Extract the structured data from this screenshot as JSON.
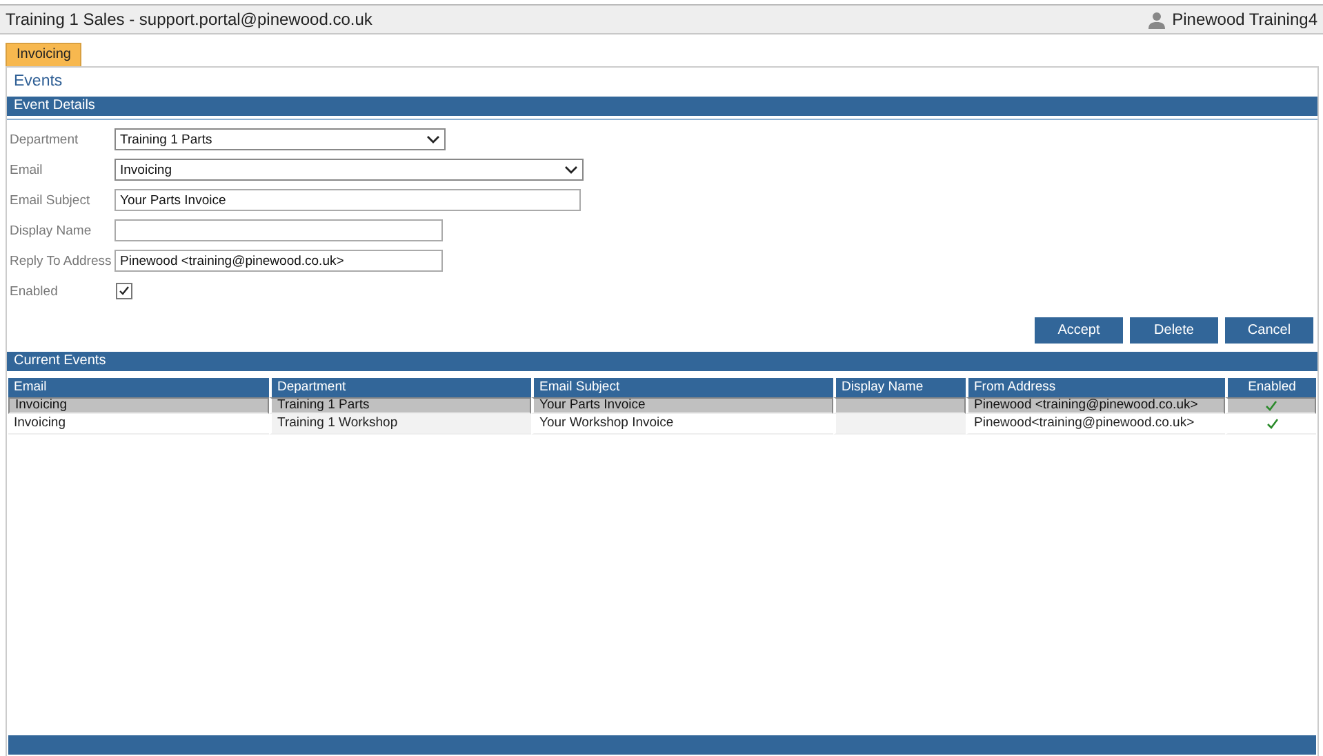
{
  "window": {
    "title": "Training 1 Sales - support.portal@pinewood.co.uk",
    "user": "Pinewood Training4"
  },
  "tabs": [
    {
      "label": "Invoicing",
      "selected": true
    }
  ],
  "page_title": "Events",
  "event_details": {
    "title": "Event Details",
    "fields": [
      {
        "kind": "select",
        "label": "Department",
        "value": "Training 1 Parts"
      },
      {
        "kind": "select",
        "label": "Email",
        "value": "Invoicing"
      },
      {
        "kind": "text",
        "label": "Email Subject",
        "value": "Your Parts Invoice"
      },
      {
        "kind": "text",
        "label": "Display Name"
      },
      {
        "kind": "text",
        "label": "Reply To Address",
        "value": "Pinewood <training@pinewood.co.uk>"
      },
      {
        "kind": "checkbox",
        "label": "Enabled",
        "checked": true
      }
    ],
    "buttons": [
      "Accept",
      "Delete",
      "Cancel"
    ]
  },
  "current_events": {
    "title": "Current Events",
    "columns": [
      "Email",
      "Department",
      "Email Subject",
      "Display Name",
      "From Address",
      "Enabled"
    ],
    "rows": [
      {
        "selected": true,
        "email": "Invoicing",
        "department": "Training 1 Parts",
        "subject": "Your Parts Invoice",
        "from": "Pinewood <training@pinewood.co.uk>",
        "enabled": true
      },
      {
        "selected": false,
        "email": "Invoicing",
        "department": "Training 1 Workshop",
        "subject": "Your Workshop Invoice",
        "from": "Pinewood<training@pinewood.co.uk>",
        "enabled": true
      }
    ]
  }
}
